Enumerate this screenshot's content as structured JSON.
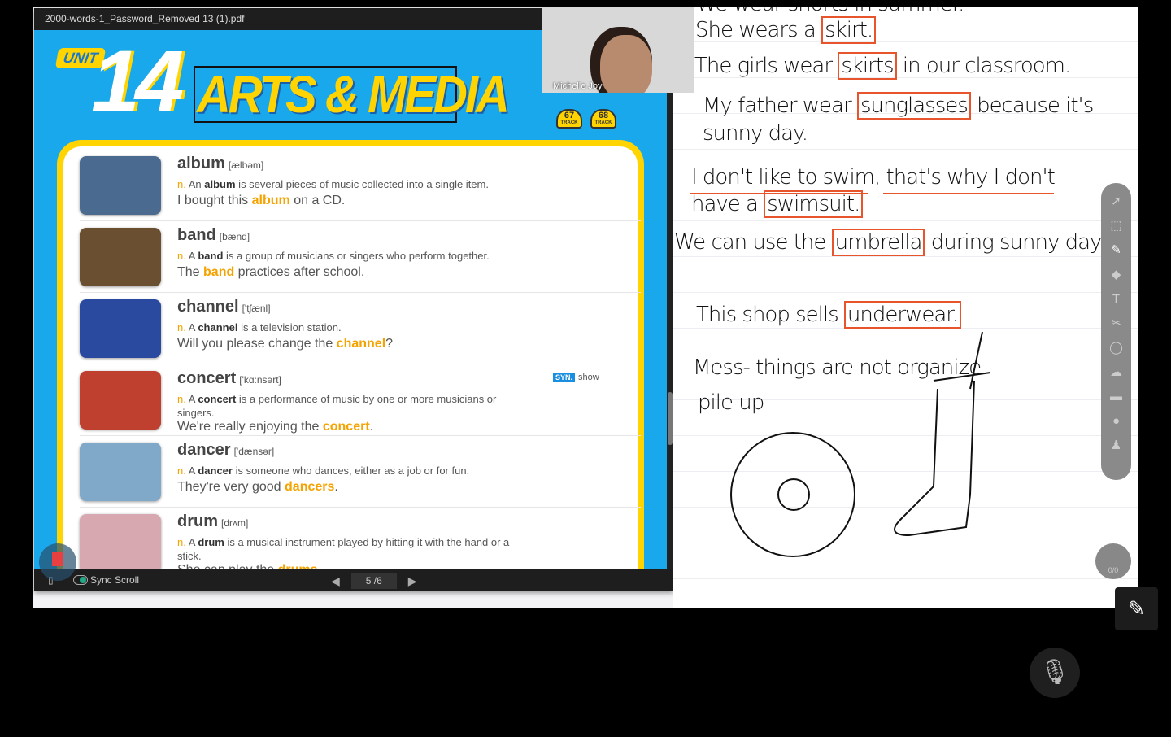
{
  "pdf": {
    "filename": "2000-words-1_Password_Removed 13 (1).pdf",
    "unit_label": "UNIT",
    "unit_number": "14",
    "unit_title": "ARTS & MEDIA",
    "tracks": [
      {
        "num": "67",
        "label": "TRACK"
      },
      {
        "num": "68",
        "label": "TRACK"
      }
    ],
    "entries": [
      {
        "word": "album",
        "phon": "[ælbəm]",
        "pos": "n.",
        "def_pre": "An ",
        "def_word": "album",
        "def_post": " is several pieces of music collected into a single item.",
        "ex_pre": "I bought this ",
        "ex_word": "album",
        "ex_post": " on a CD."
      },
      {
        "word": "band",
        "phon": "[bænd]",
        "pos": "n.",
        "def_pre": "A ",
        "def_word": "band",
        "def_post": " is a group of musicians or singers who perform together.",
        "ex_pre": "The ",
        "ex_word": "band",
        "ex_post": " practices after school."
      },
      {
        "word": "channel",
        "phon": "['tʃænl]",
        "pos": "n.",
        "def_pre": "A ",
        "def_word": "channel",
        "def_post": " is a television station.",
        "ex_pre": "Will you please change the ",
        "ex_word": "channel",
        "ex_post": "?"
      },
      {
        "word": "concert",
        "phon": "['kɑ:nsərt]",
        "pos": "n.",
        "def_pre": "A ",
        "def_word": "concert",
        "def_post": " is a performance of music by one or more musicians or singers.",
        "ex_pre": "We're really enjoying the ",
        "ex_word": "concert",
        "ex_post": ".",
        "syn_tag": "SYN.",
        "syn": "show"
      },
      {
        "word": "dancer",
        "phon": "['dænsər]",
        "pos": "n.",
        "def_pre": "A ",
        "def_word": "dancer",
        "def_post": " is someone who dances, either as a job or for fun.",
        "ex_pre": "They're very good ",
        "ex_word": "dancers",
        "ex_post": "."
      },
      {
        "word": "drum",
        "phon": "[drʌm]",
        "pos": "n.",
        "def_pre": "A ",
        "def_word": "drum",
        "def_post": " is a musical instrument played by hitting it with the hand or a stick.",
        "ex_pre": "She can play the ",
        "ex_word": "drums",
        "ex_post": "."
      }
    ],
    "toolbar": {
      "sync_scroll": "Sync Scroll",
      "page": "5 /6"
    }
  },
  "video": {
    "name": "Michelle Joy"
  },
  "board": {
    "l0": "We wear shorts in summer.",
    "l1": [
      "She wears a ",
      "skirt."
    ],
    "l2": [
      "The girls wear ",
      "skirts",
      " in our classroom."
    ],
    "l3": [
      "My father wear ",
      "sunglasses",
      " because it's"
    ],
    "l3b": "sunny day.",
    "l4": "I don't like to swim, that's why I don't",
    "l5": [
      "have a ",
      "swimsuit."
    ],
    "l6": [
      "We can use the ",
      "umbrella",
      " during sunny days."
    ],
    "l7": [
      "This shop sells ",
      "underwear."
    ],
    "l8": "Mess- things are not organize",
    "l9": "pile up",
    "seat": "0/0"
  },
  "colors": {
    "accent_blue": "#1aa8ec",
    "accent_yellow": "#ffd400",
    "highlight_orange": "#f5a300",
    "annotation_red": "#e8542c"
  }
}
